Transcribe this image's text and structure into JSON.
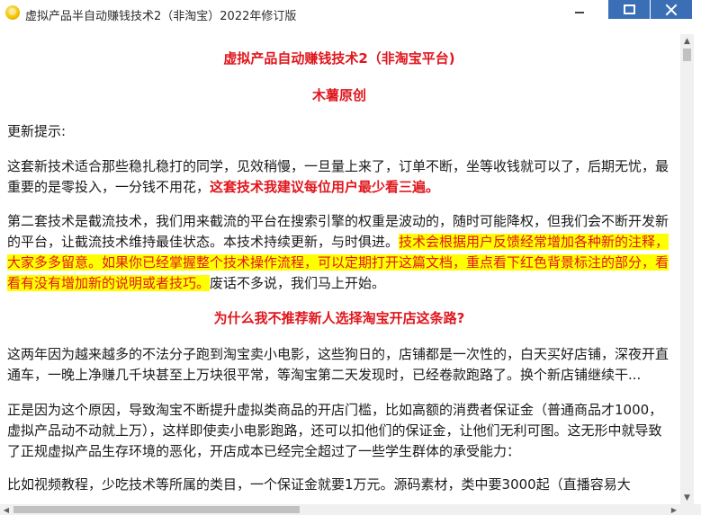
{
  "window": {
    "title": "虚拟产品半自动赚钱技术2（非淘宝）2022年修订版",
    "icon": "app-sun-icon",
    "controls": {
      "minimize": "minimize-icon",
      "maximize": "maximize-icon",
      "close": "close-icon"
    },
    "accent_color": "#3a6fb5"
  },
  "document": {
    "title": "虚拟产品自动赚钱技术2（非淘宝平台)",
    "author": "木薯原创",
    "tip_label": "更新提示:",
    "para1": {
      "text": "这套新技术适合那些稳扎稳打的同学，见效稍慢，一旦量上来了，订单不断，坐等收钱就可以了，后期无忧，最重要的是零投入，一分钱不用花，",
      "emphasis": "这套技术我建议每位用户最少看三遍。"
    },
    "para2": {
      "text": "第二套技术是截流技术，我们用来截流的平台在搜索引擎的权重是波动的，随时可能降权，但我们会不断开发新的平台，让截流技术维持最佳状态。本技术持续更新，与时俱进。",
      "highlight": "技术会根据用户反馈经常增加各种新的注释，大家多多留意。如果你已经掌握整个技术操作流程，可以定期打开这篇文档，重点看下红色背景标注的部分，看看有没有增加新的说明或者技巧。",
      "tail": "废话不多说，我们马上开始。"
    },
    "section_heading": "为什么我不推荐新人选择淘宝开店这条路?",
    "para3": "这两年因为越来越多的不法分子跑到淘宝卖小电影，这些狗日的，店铺都是一次性的，白天买好店铺，深夜开直通车，一晚上净赚几千块甚至上万块很平常，等淘宝第二天发现时，已经卷款跑路了。换个新店铺继续干...",
    "para4": "正是因为这个原因，导致淘宝不断提升虚拟类商品的开店门槛，比如高额的消费者保证金（普通商品才1000，虚拟产品动不动就上万），这样即使卖小电影跑路，还可以扣他们的保证金，让他们无利可图。这无形中就导致了正规虚拟产品生存环境的恶化，开店成本已经完全超过了一些学生群体的承受能力：",
    "para5_partial": "比如视频教程，少吃技术等所属的类目，一个保证金就要1万元。源码素材，类中要3000起（直播容易大"
  },
  "colors": {
    "emphasis_red": "#e0161d",
    "highlight_yellow": "#ffff00",
    "body_text": "#1a1a1a"
  },
  "scrollbars": {
    "up": "scroll-up-arrow-icon",
    "down": "scroll-down-arrow-icon",
    "left": "scroll-left-arrow-icon",
    "right": "scroll-right-arrow-icon"
  }
}
